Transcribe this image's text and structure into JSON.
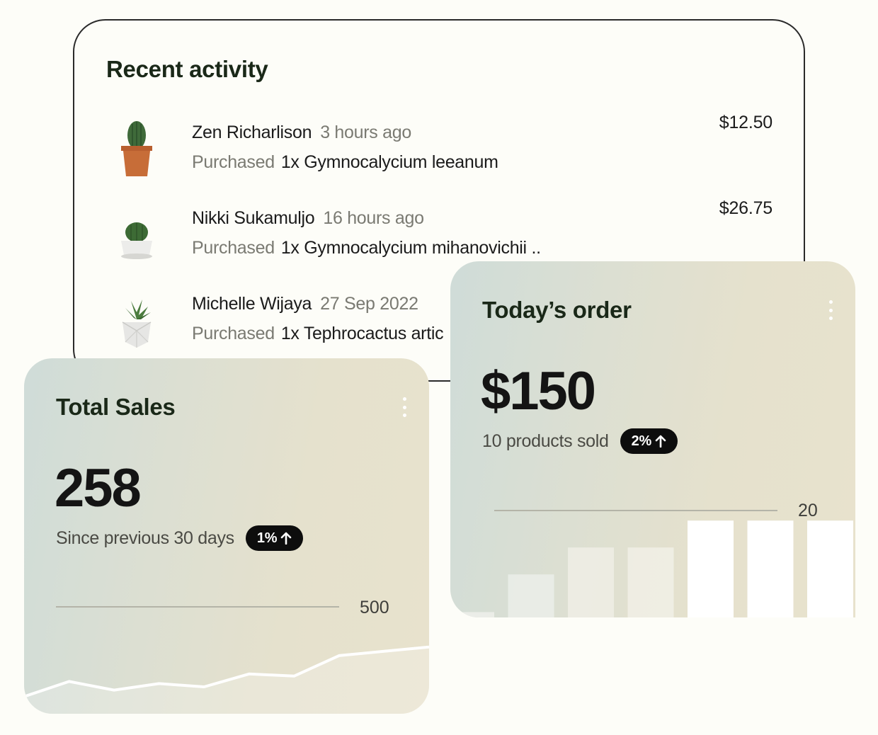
{
  "activity": {
    "title": "Recent activity",
    "items": [
      {
        "name": "Zen Richarlison",
        "time": "3 hours ago",
        "verb": "Purchased",
        "product": "1x Gymnocalycium leeanum",
        "price": "$12.50"
      },
      {
        "name": "Nikki Sukamuljo",
        "time": "16 hours ago",
        "verb": "Purchased",
        "product": "1x Gymnocalycium mihanovichii ..",
        "price": "$26.75"
      },
      {
        "name": "Michelle Wijaya",
        "time": "27 Sep 2022",
        "verb": "Purchased",
        "product": "1x Tephrocactus artic",
        "price": ""
      }
    ]
  },
  "total_sales": {
    "title": "Total Sales",
    "value": "258",
    "subtitle": "Since previous 30 days",
    "badge": "1%",
    "guide_label": "500"
  },
  "todays_order": {
    "title": "Today’s order",
    "value": "$150",
    "subtitle": "10 products sold",
    "badge": "2%",
    "guide_label": "20"
  },
  "chart_data": [
    {
      "type": "area",
      "y_max_label": 500,
      "values": [
        80,
        150,
        110,
        140,
        125,
        185,
        175,
        270,
        290,
        310
      ]
    },
    {
      "type": "bar",
      "y_max_label": 20,
      "values": [
        1,
        8,
        13,
        13,
        18,
        18,
        18
      ]
    }
  ],
  "colors": {
    "accent_dark": "#0d0d0d",
    "title_green": "#1a2818",
    "card_gradient_start": "#cfdcd8",
    "card_gradient_end": "#e8e2cd"
  }
}
